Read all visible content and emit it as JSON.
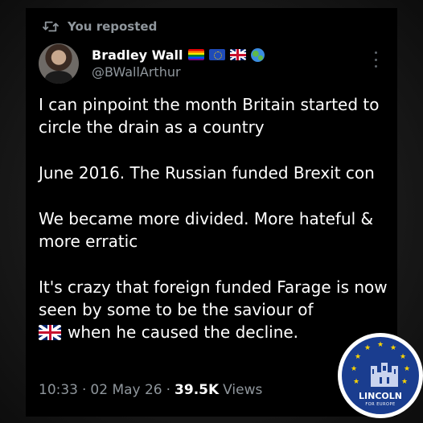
{
  "repost": {
    "label": "You reposted",
    "icon": "repost-icon"
  },
  "author": {
    "display_name": "Bradley Wall",
    "handle": "@BWallArthur",
    "name_emojis": [
      "rainbow-flag-icon",
      "eu-flag-icon",
      "uk-flag-icon",
      "globe-icon"
    ]
  },
  "tweet": {
    "paragraphs": [
      "I can pinpoint the month Britain started to circle the drain as a country",
      "June 2016. The Russian funded Brexit con",
      "We became more divided. More hateful & more erratic",
      "It's crazy that foreign funded Farage is now seen by some to be the saviour of"
    ],
    "last_line": "when he caused the decline.",
    "last_line_emoji": "uk-flag-icon"
  },
  "meta": {
    "time": "10:33",
    "sep1": "·",
    "date": "02 May 26",
    "sep2": "·",
    "views_count": "39.5K",
    "views_label": "Views"
  },
  "badge": {
    "title": "LINCOLN",
    "subtitle": "FOR EUROPE"
  },
  "colors": {
    "background": "#000000",
    "text": "#ffffff",
    "muted": "#8f969c",
    "badge_blue": "#1a3d8f",
    "badge_star": "#ffd600"
  }
}
